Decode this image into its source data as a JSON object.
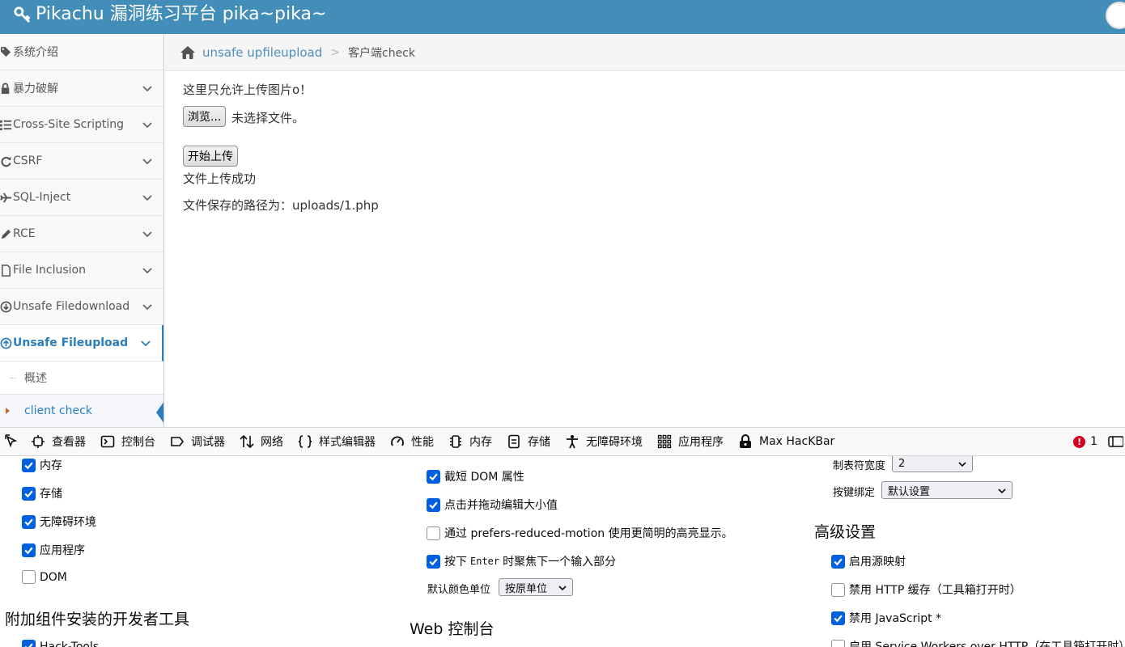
{
  "app": {
    "title": "Pikachu 漏洞练习平台 pika~pika~"
  },
  "sidebar": {
    "items": [
      {
        "label": "系统介绍",
        "icon": "tag-icon"
      },
      {
        "label": "暴力破解",
        "icon": "lock-icon"
      },
      {
        "label": "Cross-Site Scripting",
        "icon": "list-icon"
      },
      {
        "label": "CSRF",
        "icon": "refresh-icon"
      },
      {
        "label": "SQL-Inject",
        "icon": "plane-icon"
      },
      {
        "label": "RCE",
        "icon": "pencil-icon"
      },
      {
        "label": "File Inclusion",
        "icon": "file-icon"
      },
      {
        "label": "Unsafe Filedownload",
        "icon": "download-icon"
      },
      {
        "label": "Unsafe Fileupload",
        "icon": "upload-icon"
      }
    ],
    "subitems": [
      {
        "label": "概述"
      },
      {
        "label": "client check"
      }
    ]
  },
  "breadcrumb": {
    "link": "unsafe upfileupload",
    "separator": ">",
    "current": "客户端check"
  },
  "content": {
    "notice": "这里只允许上传图片o！",
    "browse_label": "浏览...",
    "no_file": "未选择文件。",
    "upload_label": "开始上传",
    "success": "文件上传成功",
    "path": "文件保存的路径为：uploads/1.php"
  },
  "devtools": {
    "tabs": [
      {
        "label": "查看器",
        "icon": "inspector-icon"
      },
      {
        "label": "控制台",
        "icon": "console-icon"
      },
      {
        "label": "调试器",
        "icon": "debugger-icon"
      },
      {
        "label": "网络",
        "icon": "network-icon"
      },
      {
        "label": "样式编辑器",
        "icon": "style-editor-icon"
      },
      {
        "label": "性能",
        "icon": "performance-icon"
      },
      {
        "label": "内存",
        "icon": "memory-icon"
      },
      {
        "label": "存储",
        "icon": "storage-icon"
      },
      {
        "label": "无障碍环境",
        "icon": "accessibility-icon"
      },
      {
        "label": "应用程序",
        "icon": "application-icon"
      },
      {
        "label": "Max HacKBar",
        "icon": "hackbar-icon"
      }
    ],
    "error_count": "1",
    "error_glyph": "!"
  },
  "settings": {
    "col1": {
      "checks": [
        {
          "label": "内存",
          "checked": true
        },
        {
          "label": "存储",
          "checked": true
        },
        {
          "label": "无障碍环境",
          "checked": true
        },
        {
          "label": "应用程序",
          "checked": true
        },
        {
          "label": "DOM",
          "checked": false
        }
      ],
      "heading": "附加组件安装的开发者工具",
      "partial": "Hack-Tools"
    },
    "col2": {
      "checks": [
        {
          "label": "截短 DOM 属性",
          "checked": true
        },
        {
          "label": "点击并拖动编辑大小值",
          "checked": true
        },
        {
          "label": "通过 prefers-reduced-motion 使用更简明的高亮显示。",
          "checked": false
        }
      ],
      "enter_pre": "按下",
      "enter_key": "Enter",
      "enter_post": "时聚焦下一个输入部分",
      "color_unit_label": "默认颜色单位",
      "color_unit_value": "按原单位",
      "heading": "Web 控制台"
    },
    "col3": {
      "tab_width_label": "制表符宽度",
      "tab_width_value": "2",
      "keybinding_label": "按键绑定",
      "keybinding_value": "默认设置",
      "heading": "高级设置",
      "checks": [
        {
          "label": "启用源映射",
          "checked": true
        },
        {
          "label": "禁用 HTTP 缓存（工具箱打开时）",
          "checked": false
        },
        {
          "label": "禁用 JavaScript *",
          "checked": true
        },
        {
          "label": "启用 Service Workers over HTTP（在工具箱打开时）",
          "checked": false
        }
      ]
    }
  },
  "colors": {
    "navbar": "#438eb9",
    "link": "#2b7dbc",
    "checkbox": "#0060df",
    "error": "#d70022"
  }
}
